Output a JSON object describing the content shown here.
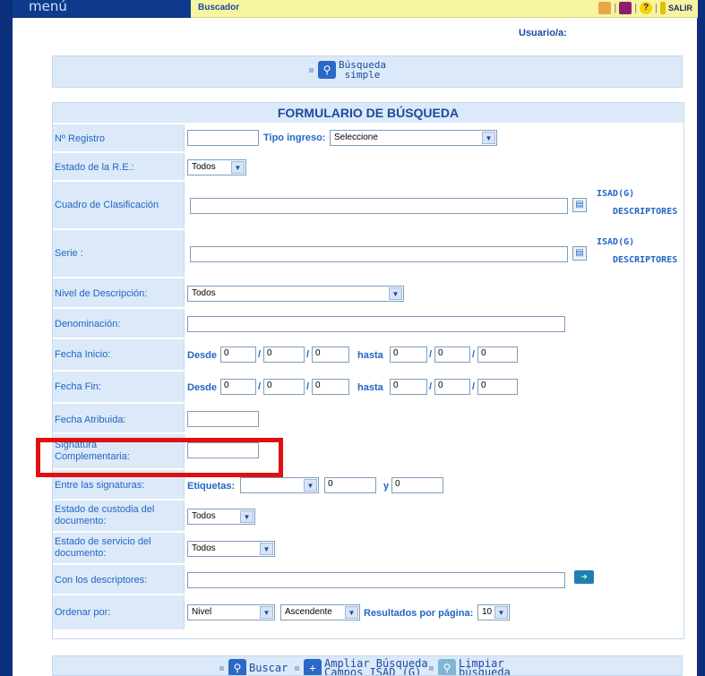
{
  "header": {
    "menu_label": "menú",
    "tab_label": "Buscador",
    "salir_label": "SALIR",
    "user_label": "Usuario/a:"
  },
  "simple_search": {
    "line1": "Búsqueda",
    "line2": "simple"
  },
  "form": {
    "title": "FORMULARIO DE BÚSQUEDA",
    "rows": {
      "registro": {
        "label": "Nº Registro",
        "tipo_label": "Tipo ingreso:",
        "tipo_value": "Seleccione"
      },
      "estado_re": {
        "label": "Estado de la R.E.:",
        "value": "Todos"
      },
      "cuadro": {
        "label": "Cuadro de Clasificación",
        "link1": "ISAD(G)",
        "link2": "DESCRIPTORES"
      },
      "serie": {
        "label": "Serie :",
        "link1": "ISAD(G)",
        "link2": "DESCRIPTORES"
      },
      "nivel": {
        "label": "Nivel de Descripción:",
        "value": "Todos"
      },
      "denominacion": {
        "label": "Denominación:"
      },
      "fecha_inicio": {
        "label": "Fecha Inicio:",
        "desde": "Desde",
        "hasta": "hasta",
        "v": "0"
      },
      "fecha_fin": {
        "label": "Fecha Fin:",
        "desde": "Desde",
        "hasta": "hasta",
        "v": "0"
      },
      "fecha_atribuida": {
        "label": "Fecha Atribuida:"
      },
      "signatura": {
        "label": "Signatura Complementaria:"
      },
      "entre": {
        "label": "Entre las signaturas:",
        "etiquetas": "Etiquetas:",
        "y": "y",
        "v1": "0",
        "v2": "0"
      },
      "custodia": {
        "label": "Estado de custodia del documento:",
        "value": "Todos"
      },
      "servicio": {
        "label": "Estado de servicio del documento:",
        "value": "Todos"
      },
      "descriptores": {
        "label": "Con los descriptores:"
      },
      "ordenar": {
        "label": "Ordenar por:",
        "value1": "Nivel",
        "value2": "Ascendente",
        "resultados_label": "Resultados por página:",
        "resultados_value": "10"
      }
    },
    "separator": "/"
  },
  "bottom": {
    "buscar": "Buscar",
    "ampliar1": "Ampliar Búsqueda",
    "ampliar2": "Campos ISAD (G)",
    "limpiar1": "Limpiar",
    "limpiar2": "búsqueda"
  },
  "colors": {
    "accent_blue": "#1c4aa0",
    "row_bg": "#dbe9f8",
    "highlight": "#e01010",
    "header_navy": "#0f3a8c"
  }
}
